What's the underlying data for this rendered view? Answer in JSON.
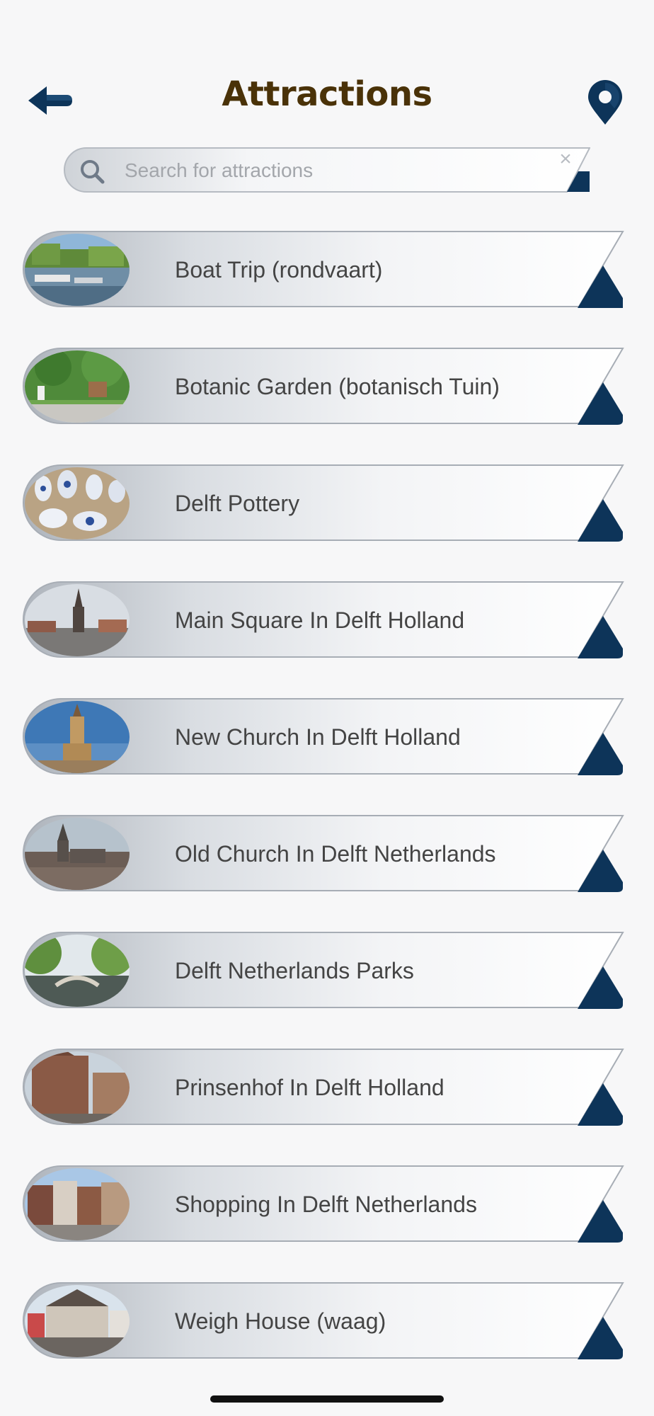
{
  "header": {
    "title": "Attractions",
    "back_icon": "arrow-left-icon",
    "map_icon": "map-pin-icon",
    "accent_color": "#0d3459",
    "title_color": "#4a3208"
  },
  "search": {
    "placeholder": "Search for attractions",
    "value": "",
    "clear_label": "×"
  },
  "attractions": [
    {
      "label": "Boat Trip (rondvaart)",
      "thumbnail": "canal-boats-photo"
    },
    {
      "label": "Botanic Garden (botanisch Tuin)",
      "thumbnail": "garden-photo"
    },
    {
      "label": "Delft Pottery",
      "thumbnail": "blue-white-pottery-photo"
    },
    {
      "label": "Main Square In Delft Holland",
      "thumbnail": "town-square-photo"
    },
    {
      "label": "New Church In Delft Holland",
      "thumbnail": "church-tower-photo"
    },
    {
      "label": "Old Church In Delft Netherlands",
      "thumbnail": "old-church-aerial-photo"
    },
    {
      "label": "Delft Netherlands Parks",
      "thumbnail": "park-bridge-photo"
    },
    {
      "label": "Prinsenhof In Delft Holland",
      "thumbnail": "brick-building-photo"
    },
    {
      "label": "Shopping In Delft Netherlands",
      "thumbnail": "shopping-street-photo"
    },
    {
      "label": "Weigh House (waag)",
      "thumbnail": "weigh-house-photo"
    }
  ]
}
